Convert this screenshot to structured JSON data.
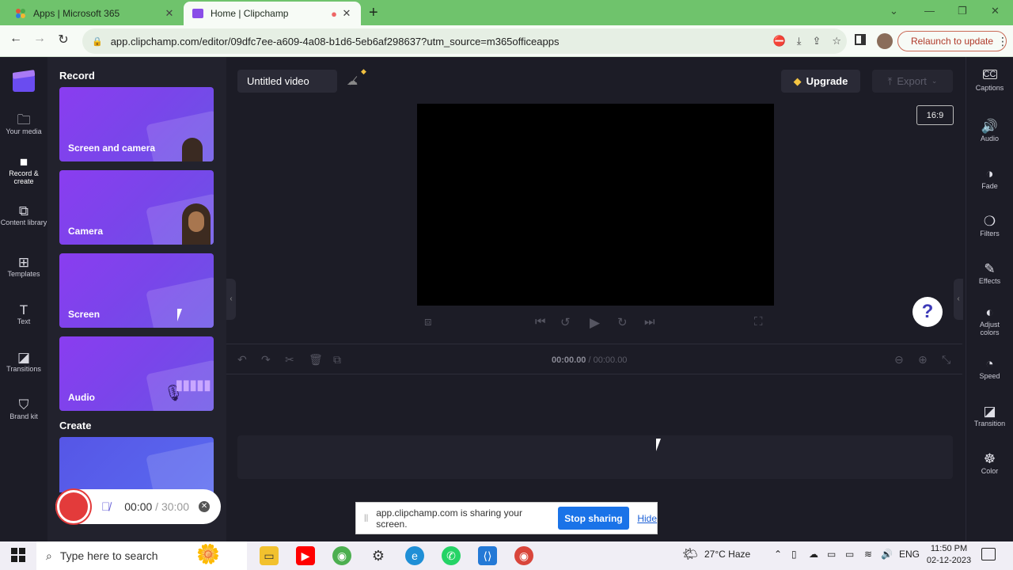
{
  "browser": {
    "tabs": [
      {
        "title": "Apps | Microsoft 365",
        "active": false
      },
      {
        "title": "Home | Clipchamp",
        "active": true
      }
    ],
    "url": "app.clipchamp.com/editor/09dfc7ee-a609-4a08-b1d6-5eb6af298637?utm_source=m365officeapps",
    "relaunch_label": "Relaunch to update"
  },
  "left_rail": {
    "items": [
      {
        "label": "Your media",
        "icon": "folder-icon"
      },
      {
        "label": "Record & create",
        "icon": "camera-icon",
        "active": true
      },
      {
        "label": "Content library",
        "icon": "content-library-icon"
      },
      {
        "label": "Templates",
        "icon": "templates-icon"
      },
      {
        "label": "Text",
        "icon": "text-icon"
      },
      {
        "label": "Transitions",
        "icon": "transitions-icon"
      },
      {
        "label": "Brand kit",
        "icon": "brand-kit-icon"
      }
    ]
  },
  "panel": {
    "record_title": "Record",
    "cards": [
      {
        "label": "Screen and camera"
      },
      {
        "label": "Camera"
      },
      {
        "label": "Screen"
      },
      {
        "label": "Audio"
      }
    ],
    "create_title": "Create"
  },
  "recorder": {
    "elapsed": "00:00",
    "separator": " / ",
    "limit": "30:00"
  },
  "editor": {
    "project_title": "Untitled video",
    "upgrade_label": "Upgrade",
    "export_label": "Export",
    "aspect_ratio": "16:9",
    "current_time": "00:00.00",
    "time_separator": " / ",
    "total_time": "00:00.00"
  },
  "right_rail": {
    "items": [
      {
        "label": "Captions",
        "icon": "captions-icon"
      },
      {
        "label": "Audio",
        "icon": "speaker-icon"
      },
      {
        "label": "Fade",
        "icon": "fade-icon"
      },
      {
        "label": "Filters",
        "icon": "filters-icon"
      },
      {
        "label": "Effects",
        "icon": "effects-icon"
      },
      {
        "label": "Adjust colors",
        "icon": "adjust-colors-icon"
      },
      {
        "label": "Speed",
        "icon": "speed-icon"
      },
      {
        "label": "Transition",
        "icon": "transition-icon"
      },
      {
        "label": "Color",
        "icon": "color-icon"
      }
    ]
  },
  "share_notice": {
    "message": "app.clipchamp.com is sharing your screen.",
    "stop_label": "Stop sharing",
    "hide_label": "Hide"
  },
  "taskbar": {
    "search_placeholder": "Type here to search",
    "weather": "27°C  Haze",
    "language": "ENG",
    "time": "11:50 PM",
    "date": "02-12-2023"
  },
  "colors": {
    "accent_purple": "#7a45ea",
    "record_red": "#e33b3b",
    "stop_sharing_blue": "#1a73e8",
    "upgrade_gem": "#f5c542"
  }
}
